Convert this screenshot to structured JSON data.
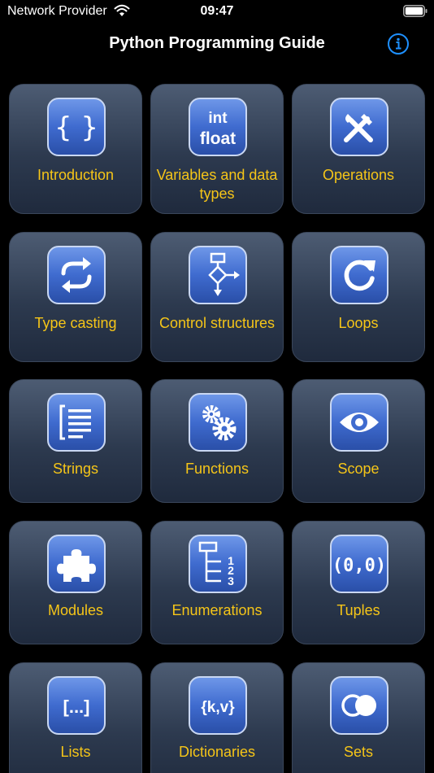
{
  "status_bar": {
    "carrier": "Network Provider",
    "time": "09:47"
  },
  "header": {
    "title": "Python Programming Guide",
    "info_icon": "info-icon"
  },
  "accent_color": "#f5c518",
  "topics": [
    {
      "label": "Introduction",
      "icon_text": "{ }",
      "icon": "braces-icon"
    },
    {
      "label": "Variables and data types",
      "icon_text": "int float",
      "icon": "int-float-icon"
    },
    {
      "label": "Operations",
      "icon": "tools-icon"
    },
    {
      "label": "Type casting",
      "icon": "convert-arrows-icon"
    },
    {
      "label": "Control structures",
      "icon": "flowchart-icon"
    },
    {
      "label": "Loops",
      "icon": "loop-arrow-icon"
    },
    {
      "label": "Strings",
      "icon": "text-lines-icon"
    },
    {
      "label": "Functions",
      "icon": "gears-icon"
    },
    {
      "label": "Scope",
      "icon": "eye-icon"
    },
    {
      "label": "Modules",
      "icon": "puzzle-icon"
    },
    {
      "label": "Enumerations",
      "icon_text": "1 2 3",
      "icon": "numbered-list-icon"
    },
    {
      "label": "Tuples",
      "icon_text": "(0,0)",
      "icon": "tuple-icon"
    },
    {
      "label": "Lists",
      "icon_text": "[...]",
      "icon": "list-brackets-icon"
    },
    {
      "label": "Dictionaries",
      "icon_text": "{k,v}",
      "icon": "dictionary-icon"
    },
    {
      "label": "Sets",
      "icon": "sets-icon"
    }
  ]
}
